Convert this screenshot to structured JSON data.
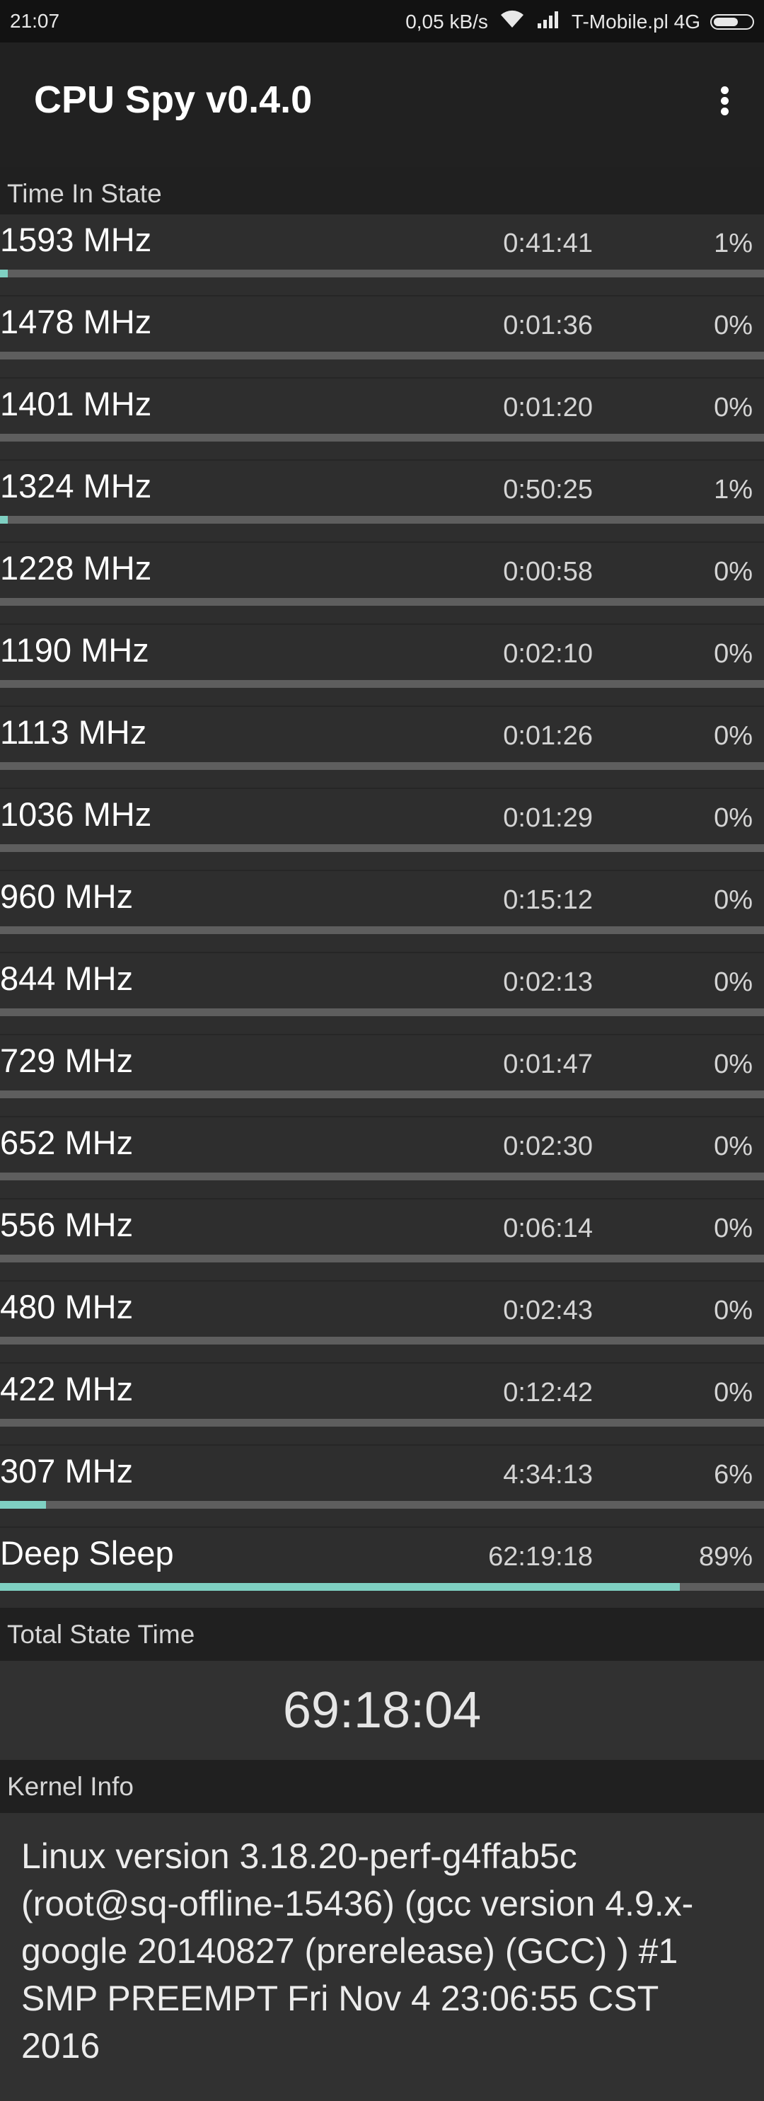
{
  "status_bar": {
    "time": "21:07",
    "speed": "0,05 kB/s",
    "carrier": "T-Mobile.pl 4G",
    "icons": [
      "wifi-icon",
      "signal-icon",
      "battery-icon"
    ]
  },
  "app_bar": {
    "title": "CPU Spy v0.4.0",
    "menu_icon": "overflow-menu-icon"
  },
  "time_in_state": {
    "header": "Time In State",
    "accent_color": "#7fd0c2",
    "rows": [
      {
        "freq": "1593 MHz",
        "time": "0:41:41",
        "percent": "1%",
        "fraction": 0.01
      },
      {
        "freq": "1478 MHz",
        "time": "0:01:36",
        "percent": "0%",
        "fraction": 0.0
      },
      {
        "freq": "1401 MHz",
        "time": "0:01:20",
        "percent": "0%",
        "fraction": 0.0
      },
      {
        "freq": "1324 MHz",
        "time": "0:50:25",
        "percent": "1%",
        "fraction": 0.01
      },
      {
        "freq": "1228 MHz",
        "time": "0:00:58",
        "percent": "0%",
        "fraction": 0.0
      },
      {
        "freq": "1190 MHz",
        "time": "0:02:10",
        "percent": "0%",
        "fraction": 0.0
      },
      {
        "freq": "1113 MHz",
        "time": "0:01:26",
        "percent": "0%",
        "fraction": 0.0
      },
      {
        "freq": "1036 MHz",
        "time": "0:01:29",
        "percent": "0%",
        "fraction": 0.0
      },
      {
        "freq": "960 MHz",
        "time": "0:15:12",
        "percent": "0%",
        "fraction": 0.0
      },
      {
        "freq": "844 MHz",
        "time": "0:02:13",
        "percent": "0%",
        "fraction": 0.0
      },
      {
        "freq": "729 MHz",
        "time": "0:01:47",
        "percent": "0%",
        "fraction": 0.0
      },
      {
        "freq": "652 MHz",
        "time": "0:02:30",
        "percent": "0%",
        "fraction": 0.0
      },
      {
        "freq": "556 MHz",
        "time": "0:06:14",
        "percent": "0%",
        "fraction": 0.0
      },
      {
        "freq": "480 MHz",
        "time": "0:02:43",
        "percent": "0%",
        "fraction": 0.0
      },
      {
        "freq": "422 MHz",
        "time": "0:12:42",
        "percent": "0%",
        "fraction": 0.0
      },
      {
        "freq": "307 MHz",
        "time": "4:34:13",
        "percent": "6%",
        "fraction": 0.06
      },
      {
        "freq": "Deep Sleep",
        "time": "62:19:18",
        "percent": "89%",
        "fraction": 0.89
      }
    ]
  },
  "total_state_time": {
    "header": "Total State Time",
    "value": "69:18:04"
  },
  "kernel_info": {
    "header": "Kernel Info",
    "text": "Linux version 3.18.20-perf-g4ffab5c (root@sq-offline-15436) (gcc version 4.9.x-google 20140827 (prerelease) (GCC) ) #1 SMP PREEMPT Fri Nov 4 23:06:55 CST 2016"
  }
}
